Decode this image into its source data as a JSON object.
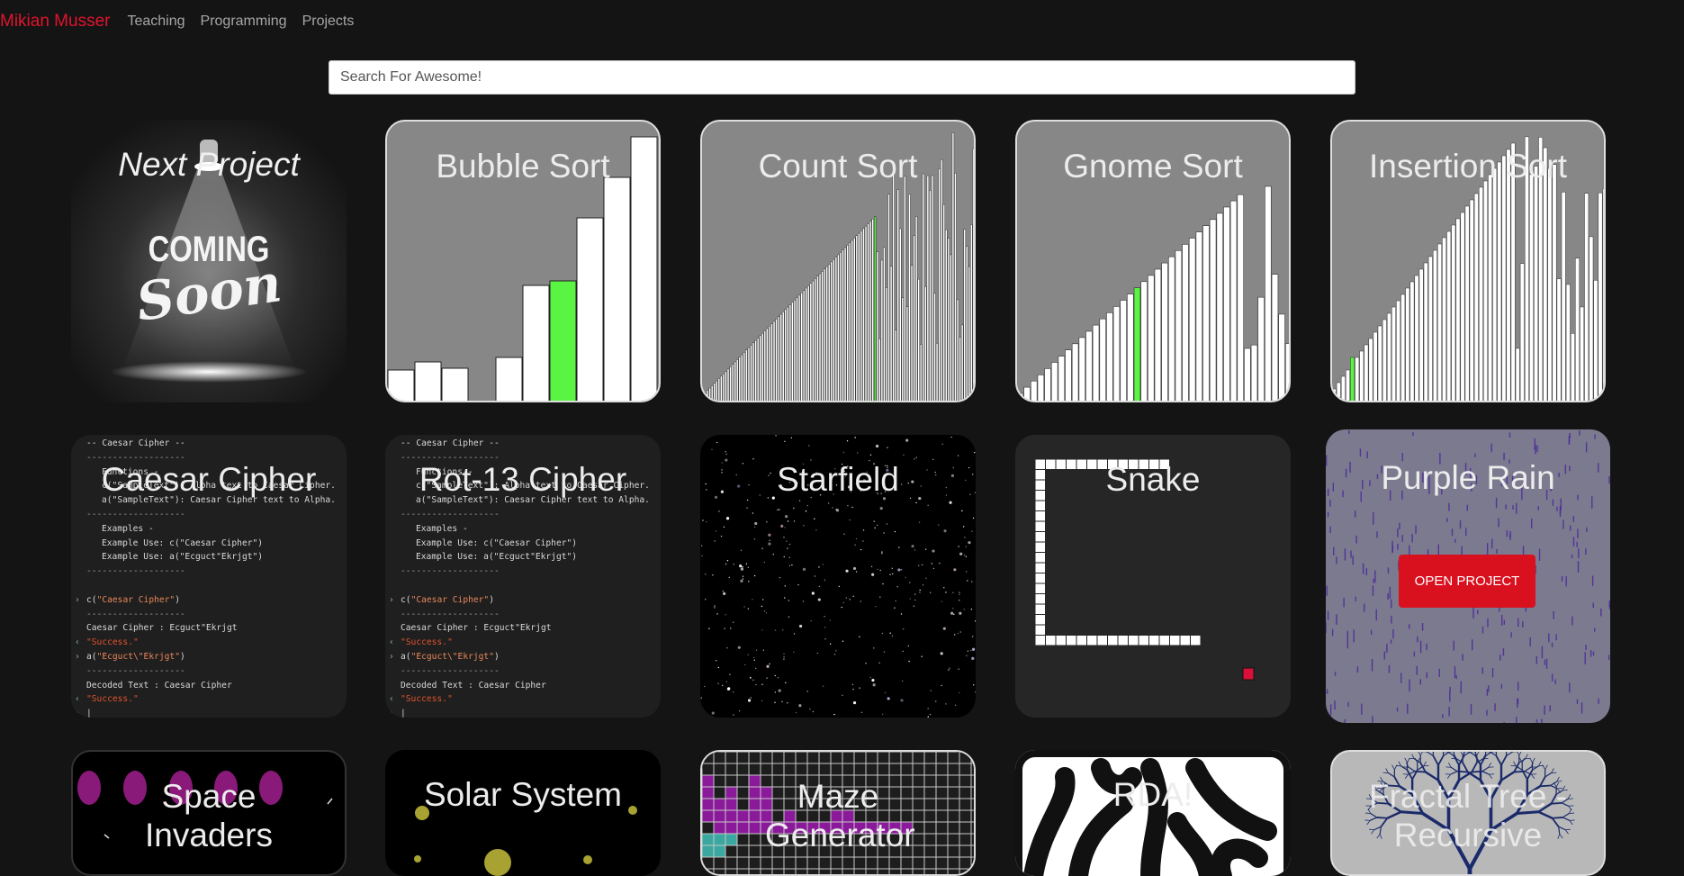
{
  "brand": "Mikian Musser",
  "nav": [
    "Teaching",
    "Programming",
    "Projects"
  ],
  "search": {
    "placeholder": "Search For Awesome!"
  },
  "cards": [
    {
      "title": "Next Project",
      "badge_line1": "COMING",
      "badge_line2": "Soon"
    },
    {
      "title": "Bubble Sort"
    },
    {
      "title": "Count Sort"
    },
    {
      "title": "Gnome Sort"
    },
    {
      "title": "Insertion Sort"
    },
    {
      "title": "Caesar Cipher"
    },
    {
      "title": "Rot-13 Cipher"
    },
    {
      "title": "Starfield"
    },
    {
      "title": "Snake"
    },
    {
      "title": "Purple Rain",
      "button": "OPEN PROJECT"
    },
    {
      "title": "Space Invaders"
    },
    {
      "title": "Solar System"
    },
    {
      "title": "Maze Generator"
    },
    {
      "title": "RDA!"
    },
    {
      "title": "Fractal Tree - Recursive"
    }
  ],
  "console": {
    "header": "-- Caesar Cipher --",
    "divider": "-------------------",
    "functions": "Functions -",
    "fn1": "c(\"SampleText\"): Alpha text to Caesar Cipher.",
    "fn2": "a(\"SampleText\"): Caesar Cipher text to Alpha.",
    "examples": "Examples -",
    "ex1": "Example Use: c(\"Caesar Cipher\")",
    "ex2": "Example Use: a(\"Ecguct\"Ekrjgt\")",
    "cmd1_fn": "c(",
    "cmd1_arg": "\"Caesar Cipher\"",
    "out1": "Caesar Cipher : Ecguct\"Ekrjgt",
    "success": "\"Success.\"",
    "cmd2_fn": "a(",
    "cmd2_arg": "\"Ecguct\\\"Ekrjgt\"",
    "out2": "Decoded Text : Caesar Cipher",
    "close_paren": ")"
  },
  "colors": {
    "brand": "#e0142d",
    "highlight_bar": "#5af542",
    "button": "#d9111f",
    "purple_bg": "#7c7a8e"
  }
}
